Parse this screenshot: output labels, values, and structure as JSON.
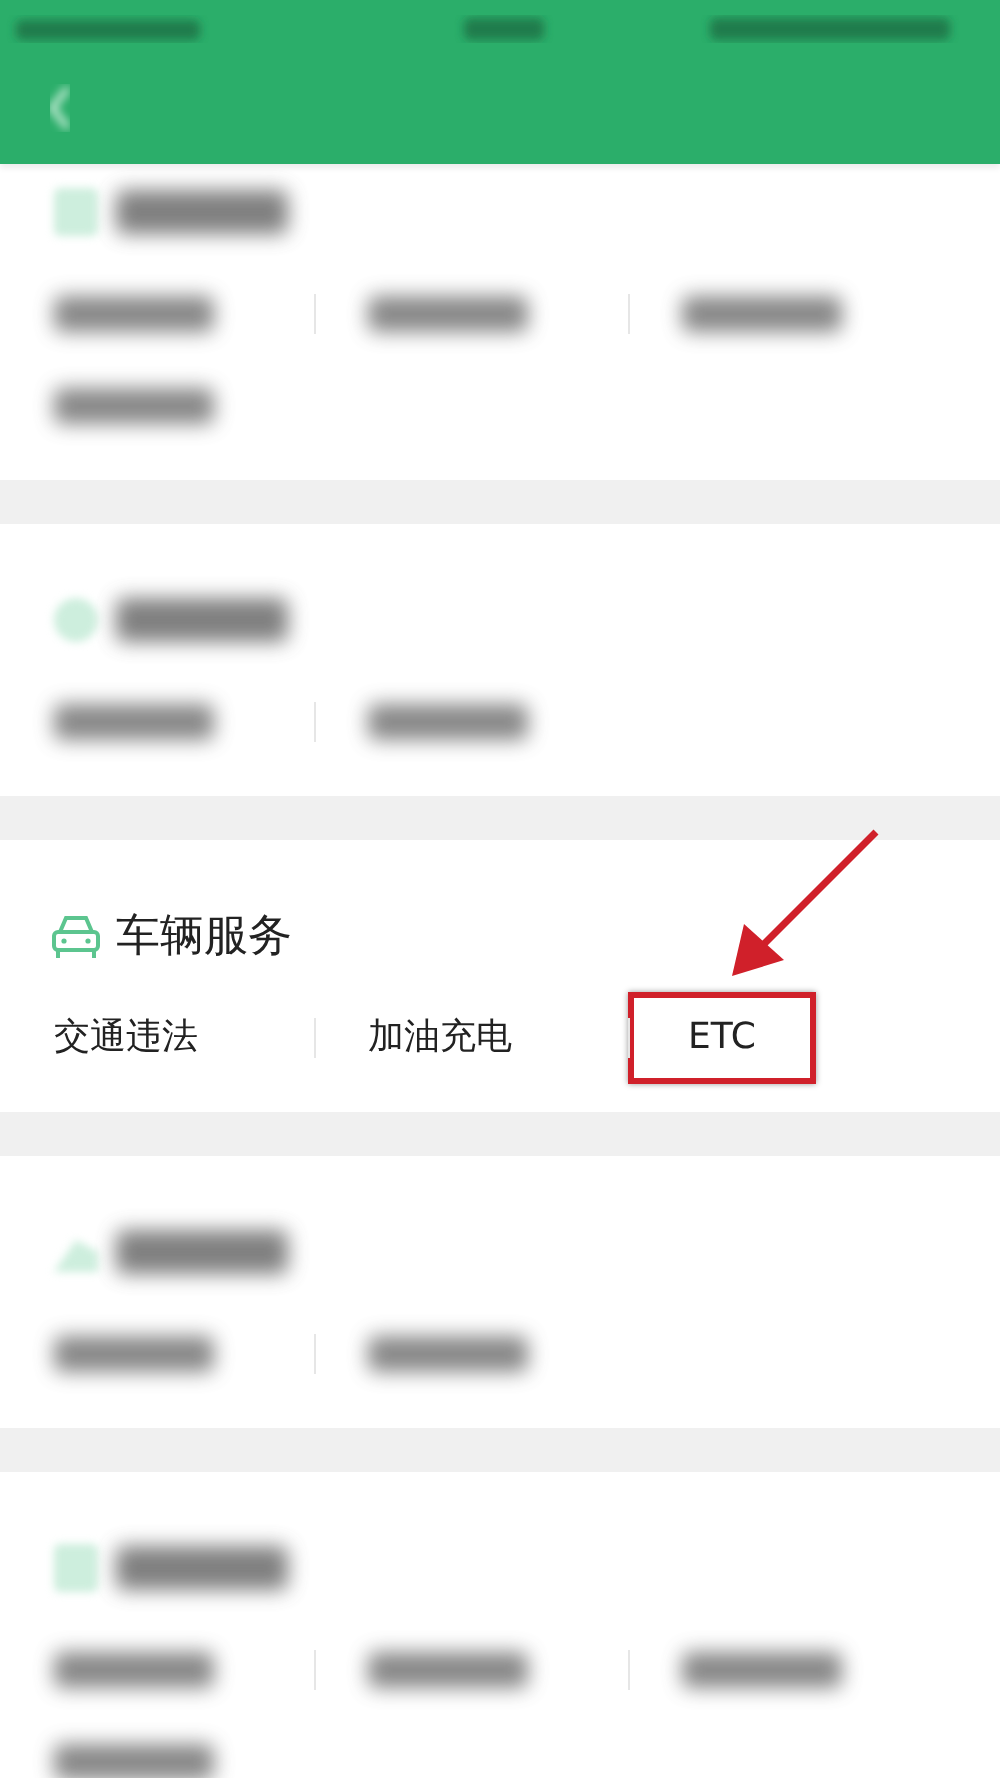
{
  "sections": [
    {
      "kind": "blurred",
      "items": [
        {
          "kind": "blurred"
        },
        {
          "kind": "blurred"
        },
        {
          "kind": "blurred"
        },
        {
          "kind": "blurred"
        }
      ]
    },
    {
      "kind": "blurred",
      "items": [
        {
          "kind": "blurred"
        },
        {
          "kind": "blurred"
        }
      ]
    },
    {
      "kind": "clear",
      "title": "车辆服务",
      "items": [
        {
          "kind": "text",
          "label": "交通违法",
          "highlighted": false
        },
        {
          "kind": "text",
          "label": "加油充电",
          "highlighted": false
        },
        {
          "kind": "text",
          "label": "ETC",
          "highlighted": true
        }
      ]
    },
    {
      "kind": "blurred",
      "items": [
        {
          "kind": "blurred"
        },
        {
          "kind": "blurred"
        }
      ]
    },
    {
      "kind": "blurred",
      "items": [
        {
          "kind": "blurred"
        },
        {
          "kind": "blurred"
        },
        {
          "kind": "blurred"
        },
        {
          "kind": "blurred"
        }
      ]
    }
  ]
}
